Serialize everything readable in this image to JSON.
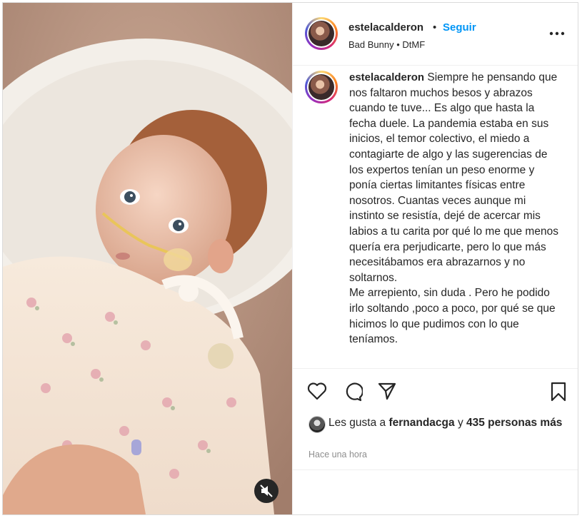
{
  "post": {
    "username": "estelacalderon",
    "separator": "•",
    "follow_label": "Seguir",
    "audio": "Bad Bunny • DtMF",
    "more_icon": "more-horizontal-icon"
  },
  "caption": {
    "username": "estelacalderon",
    "paragraph1": "Siempre he pensando que nos faltaron muchos besos y abrazos cuando te tuve... Es algo que hasta la fecha duele. La pandemia estaba en sus inicios, el temor colectivo, el miedo a contagiarte de algo y las sugerencias de los expertos tenían un peso enorme y ponía ciertas limitantes físicas entre nosotros. Cuantas veces aunque mi instinto se resistía, dejé de acercar mis labios a tu carita por qué lo me que menos quería era perjudicarte, pero lo que más necesitábamos era abrazarnos y no soltarnos.",
    "paragraph2": "Me arrepiento, sin duda . Pero he podido irlo soltando ,poco a poco, por qué se que hicimos lo que pudimos con lo que teníamos."
  },
  "actions": {
    "icons": [
      "heart-icon",
      "comment-icon",
      "share-icon",
      "bookmark-icon"
    ]
  },
  "likes": {
    "prefix": "Les gusta a",
    "user": "fernandacga",
    "connector": "y",
    "count_text": "435 personas más"
  },
  "timestamp": "Hace una hora",
  "media": {
    "mute_icon": "muted-speaker-icon",
    "colors": {
      "background": "#d7b9a6",
      "accent": "#0095f6"
    }
  }
}
